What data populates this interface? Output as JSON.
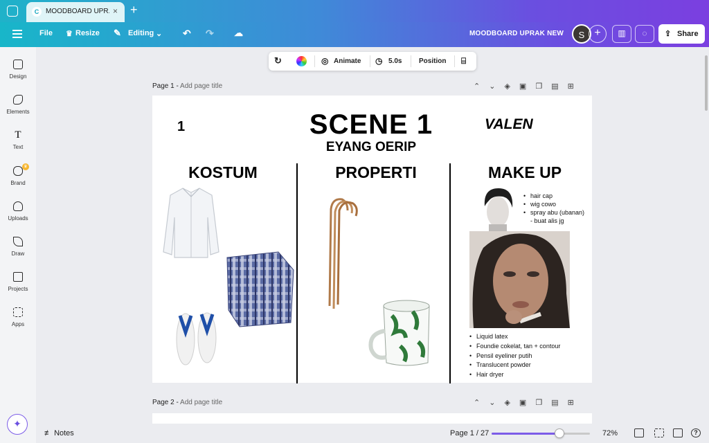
{
  "browser": {
    "tab_title": "MOODBOARD UPR...",
    "tab_close": "×",
    "new_tab": "+"
  },
  "toolbar": {
    "file": "File",
    "resize": "Resize",
    "editing": "Editing",
    "design_title": "MOODBOARD UPRAK NEW",
    "avatar_initial": "S",
    "add": "+",
    "share": "Share"
  },
  "sidebar": {
    "items": [
      {
        "label": "Design",
        "icon": "design-icon"
      },
      {
        "label": "Elements",
        "icon": "elements-icon"
      },
      {
        "label": "Text",
        "icon": "text-icon"
      },
      {
        "label": "Brand",
        "icon": "brand-icon"
      },
      {
        "label": "Uploads",
        "icon": "uploads-icon"
      },
      {
        "label": "Draw",
        "icon": "draw-icon"
      },
      {
        "label": "Projects",
        "icon": "projects-icon"
      },
      {
        "label": "Apps",
        "icon": "apps-icon"
      }
    ]
  },
  "context_toolbar": {
    "animate": "Animate",
    "duration": "5.0s",
    "position": "Position"
  },
  "pages": [
    {
      "label": "Page 1 -",
      "placeholder": "Add page title"
    },
    {
      "label": "Page 2 -",
      "placeholder": "Add page title"
    }
  ],
  "slide": {
    "number": "1",
    "scene": "SCENE 1",
    "character": "EYANG OERIP",
    "actor": "VALEN",
    "columns": [
      "KOSTUM",
      "PROPERTI",
      "MAKE UP"
    ],
    "makeup_top_list": [
      "hair cap",
      "wig cowo",
      "spray abu (ubanan)",
      "- buat alis jg"
    ],
    "makeup_bottom_list": [
      "Liquid latex",
      "Foundie cokelat, tan + contour",
      "Pensil eyeliner putih",
      "Translucent powder",
      "Hair dryer"
    ]
  },
  "bottom_bar": {
    "notes": "Notes",
    "page_indicator": "Page 1 / 27",
    "zoom": "72%",
    "zoom_level": 0.72
  },
  "colors": {
    "accent": "#7c5ce8",
    "gradient_start": "#18b6c9",
    "gradient_end": "#7b3fe0"
  }
}
